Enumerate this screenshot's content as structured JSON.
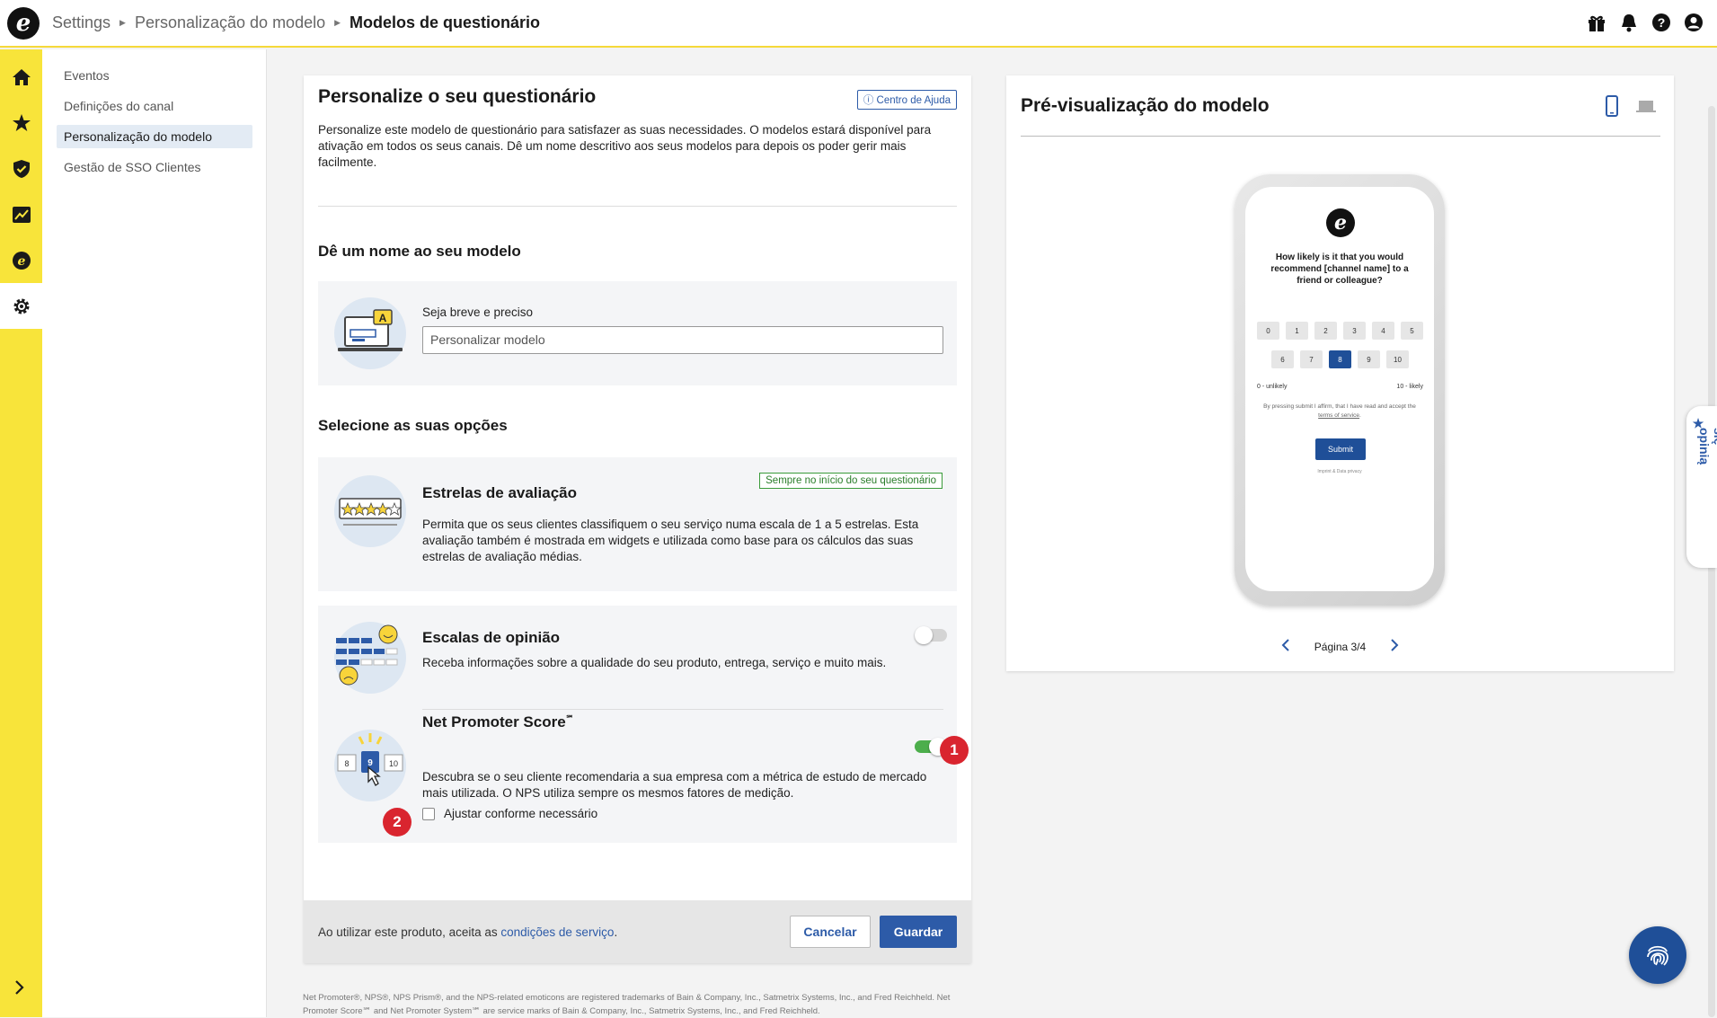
{
  "breadcrumb": {
    "items": [
      "Settings",
      "Personalização do modelo"
    ],
    "current": "Modelos de questionário"
  },
  "subnav": {
    "items": [
      "Eventos",
      "Definições do canal",
      "Personalização do modelo",
      "Gestão de SSO Clientes"
    ],
    "selected": "Personalização do modelo"
  },
  "main": {
    "title": "Personalize o seu questionário",
    "help_link": "Centro de Ajuda",
    "intro": "Personalize este modelo de questionário para satisfazer as suas necessidades. O modelos estará disponível para ativação em todos os seus canais. Dê um nome descritivo aos seus modelos para depois os poder gerir mais facilmente.",
    "name_section": {
      "title": "Dê um nome ao seu modelo",
      "label": "Seja breve e preciso",
      "placeholder": "Personalizar modelo"
    },
    "options_title": "Selecione as suas opções",
    "stars": {
      "title": "Estrelas de avaliação",
      "badge": "Sempre no início do seu questionário",
      "desc": "Permita que os seus clientes classifiquem o seu serviço numa escala de 1 a 5 estrelas. Esta avaliação também é mostrada em widgets e utilizada como base para os cálculos das suas estrelas de avaliação médias."
    },
    "opinion": {
      "title": "Escalas de opinião",
      "desc": "Receba informações sobre a qualidade do seu produto, entrega, serviço e muito mais.",
      "enabled": false
    },
    "nps": {
      "title": "Net Promoter Score",
      "tm": "℠",
      "desc": "Descubra se o seu cliente recomendaria a sua empresa com a métrica de estudo de mercado mais utilizada. O NPS utiliza sempre os mesmos fatores de medição.",
      "enabled": true,
      "adjust_label": "Ajustar conforme necessário",
      "illu_numbers": [
        "8",
        "9",
        "10"
      ]
    },
    "markers": [
      "1",
      "2"
    ],
    "footer": {
      "text": "Ao utilizar este produto, aceita as ",
      "link": "condições de serviço",
      "end": ".",
      "cancel": "Cancelar",
      "save": "Guardar"
    }
  },
  "disclaimer": "Net Promoter®, NPS®, NPS Prism®, and the NPS-related emoticons are registered trademarks of Bain & Company, Inc., Satmetrix Systems, Inc., and Fred Reichheld. Net Promoter Score℠ and Net Promoter System℠ are service marks of Bain & Company, Inc., Satmetrix Systems, Inc., and Fred Reichheld.",
  "preview": {
    "title": "Pré-visualização do modelo",
    "question": "How likely is it that you would recommend [channel name] to a friend or colleague?",
    "scale_row1": [
      "0",
      "1",
      "2",
      "3",
      "4",
      "5"
    ],
    "scale_row2": [
      "6",
      "7",
      "8",
      "9",
      "10"
    ],
    "selected": "8",
    "low_label": "0 - unlikely",
    "high_label": "10 - likely",
    "fine_print": "By pressing submit I affirm, that I have read and accept the",
    "terms_link": "terms of service",
    "submit": "Submit",
    "imprint": "Imprint & Data privacy",
    "page": "Página 3/4"
  },
  "feedback_tab": "Podziel się opinią",
  "colors": {
    "accent": "#2d5ba8",
    "rail": "#f8e43a",
    "marker": "#d9252f",
    "toggle_on": "#4cae4c"
  }
}
